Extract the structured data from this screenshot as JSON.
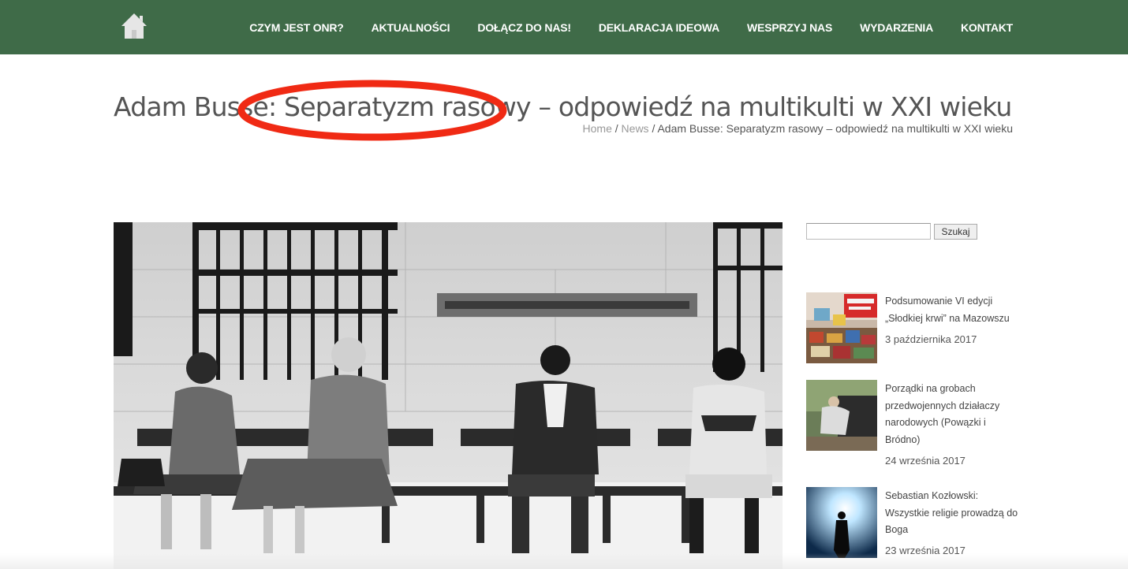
{
  "nav": {
    "items": [
      "CZYM JEST ONR?",
      "AKTUALNOŚCI",
      "DOŁĄCZ DO NAS!",
      "DEKLARACJA IDEOWA",
      "WESPRZYJ NAS",
      "WYDARZENIA",
      "KONTAKT"
    ]
  },
  "page": {
    "title": "Adam Busse: Separatyzm rasowy – odpowiedź na multikulti w XXI wieku"
  },
  "breadcrumb": {
    "home": "Home",
    "separator": " / ",
    "news": "News",
    "current": "Adam Busse: Separatyzm rasowy – odpowiedź na multikulti w XXI wieku"
  },
  "sidebar": {
    "search_button": "Szukaj",
    "posts": [
      {
        "title": "Podsumowanie VI edycji „Słodkiej krwi” na Mazowszu",
        "date": "3 października 2017"
      },
      {
        "title": "Porządki na grobach przedwojennych działaczy narodowych (Powązki i Bródno)",
        "date": "24 września 2017"
      },
      {
        "title": "Sebastian Kozłowski: Wszystkie religie prowadzą do Boga",
        "date": "23 września 2017"
      }
    ]
  },
  "colors": {
    "header_bg": "#3f6b48",
    "annotation_red": "#f02a14"
  },
  "icons": {
    "home": "home-icon"
  }
}
